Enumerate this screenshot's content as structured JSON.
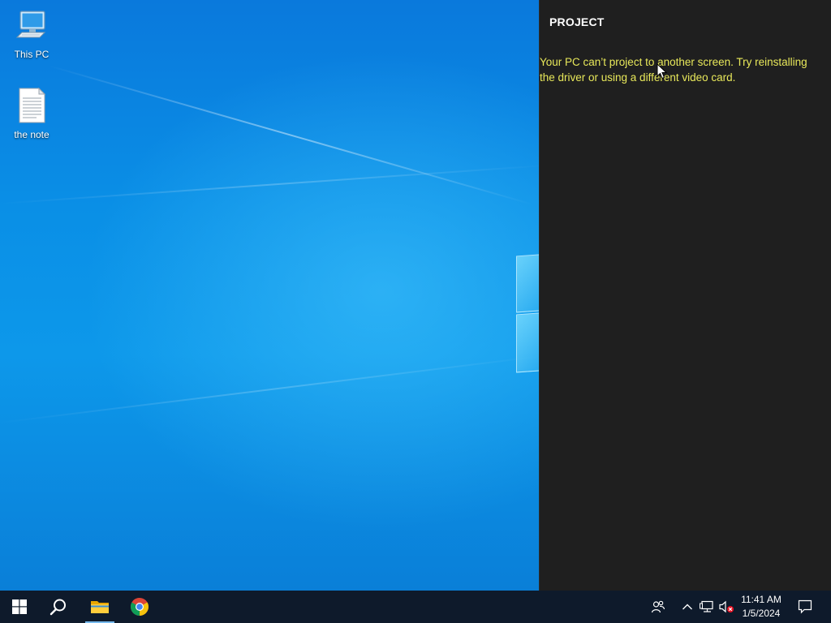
{
  "desktop": {
    "icons": [
      {
        "label": "This PC",
        "icon": "this-pc-icon"
      },
      {
        "label": "the note",
        "icon": "text-document-icon"
      }
    ]
  },
  "project_panel": {
    "title": "PROJECT",
    "message": "Your PC can’t project to another screen. Try reinstalling the driver or using a different video card.",
    "message_color": "#e8e85a",
    "background": "#1f1f1f"
  },
  "taskbar": {
    "background": "#0e1a2b",
    "pinned": [
      {
        "name": "start",
        "icon": "windows-logo-icon"
      },
      {
        "name": "search",
        "icon": "search-icon"
      },
      {
        "name": "file-explorer",
        "icon": "folder-icon",
        "active": true
      },
      {
        "name": "chrome",
        "icon": "chrome-icon"
      }
    ],
    "tray": {
      "icons": [
        "people-icon",
        "chevron-up-icon",
        "network-icon",
        "volume-muted-icon",
        "notification-icon"
      ],
      "time": "11:41 AM",
      "date": "1/5/2024"
    }
  }
}
